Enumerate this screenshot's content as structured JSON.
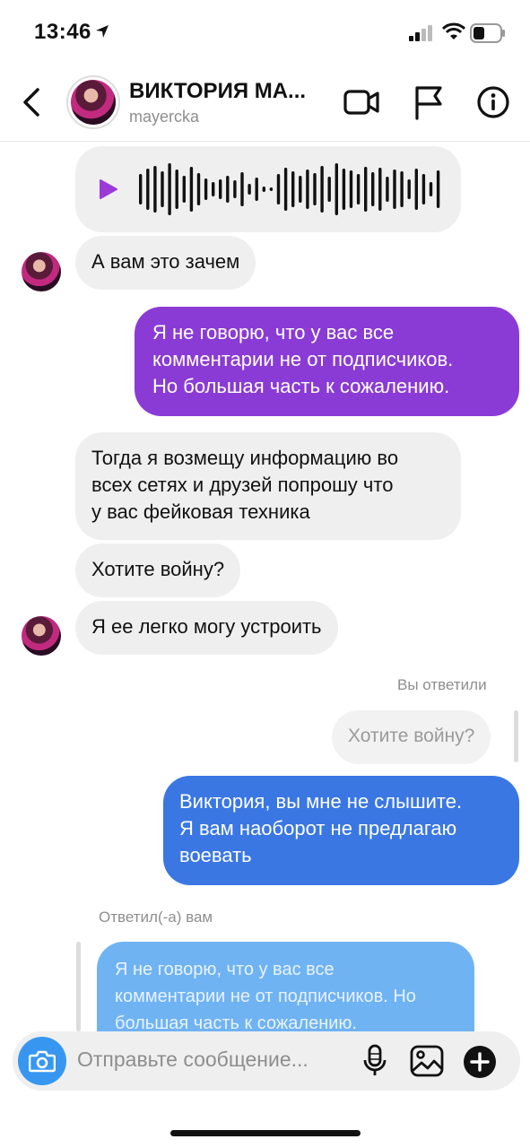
{
  "status_bar": {
    "time": "13:46"
  },
  "header": {
    "name": "ВИКТОРИЯ МА...",
    "username": "mayercka"
  },
  "messages": [
    {
      "type": "voice",
      "direction": "incoming"
    },
    {
      "type": "text",
      "direction": "incoming",
      "text": "А вам это зачем"
    },
    {
      "type": "text",
      "direction": "outgoing",
      "lines": [
        "Я не говорю, что у вас все",
        "комментарии не от подписчиков.",
        "Но большая часть к сожалению."
      ]
    },
    {
      "type": "text",
      "direction": "incoming",
      "lines": [
        "Тогда я возмещу информацию во",
        "всех сетях и друзей попрошу что",
        "у вас фейковая техника"
      ]
    },
    {
      "type": "text",
      "direction": "incoming",
      "text": "Хотите войну?"
    },
    {
      "type": "text",
      "direction": "incoming",
      "text": "Я ее легко могу устроить"
    }
  ],
  "reply_out": {
    "label": "Вы ответили",
    "quoted": "Хотите войну?",
    "lines": [
      "Виктория, вы мне не слышите.",
      "Я вам наоборот не предлагаю",
      "воевать"
    ]
  },
  "reply_in": {
    "label": "Ответил(-а) вам",
    "quoted_lines": [
      "Я не говорю, что у вас все",
      "комментарии не от подписчиков. Но",
      "большая часть к сожалению."
    ]
  },
  "composer": {
    "placeholder": "Отправьте сообщение..."
  },
  "colors": {
    "outgoing_purple": "#8a3bd5",
    "outgoing_blue": "#3a77e3",
    "camera": "#3797f0"
  }
}
